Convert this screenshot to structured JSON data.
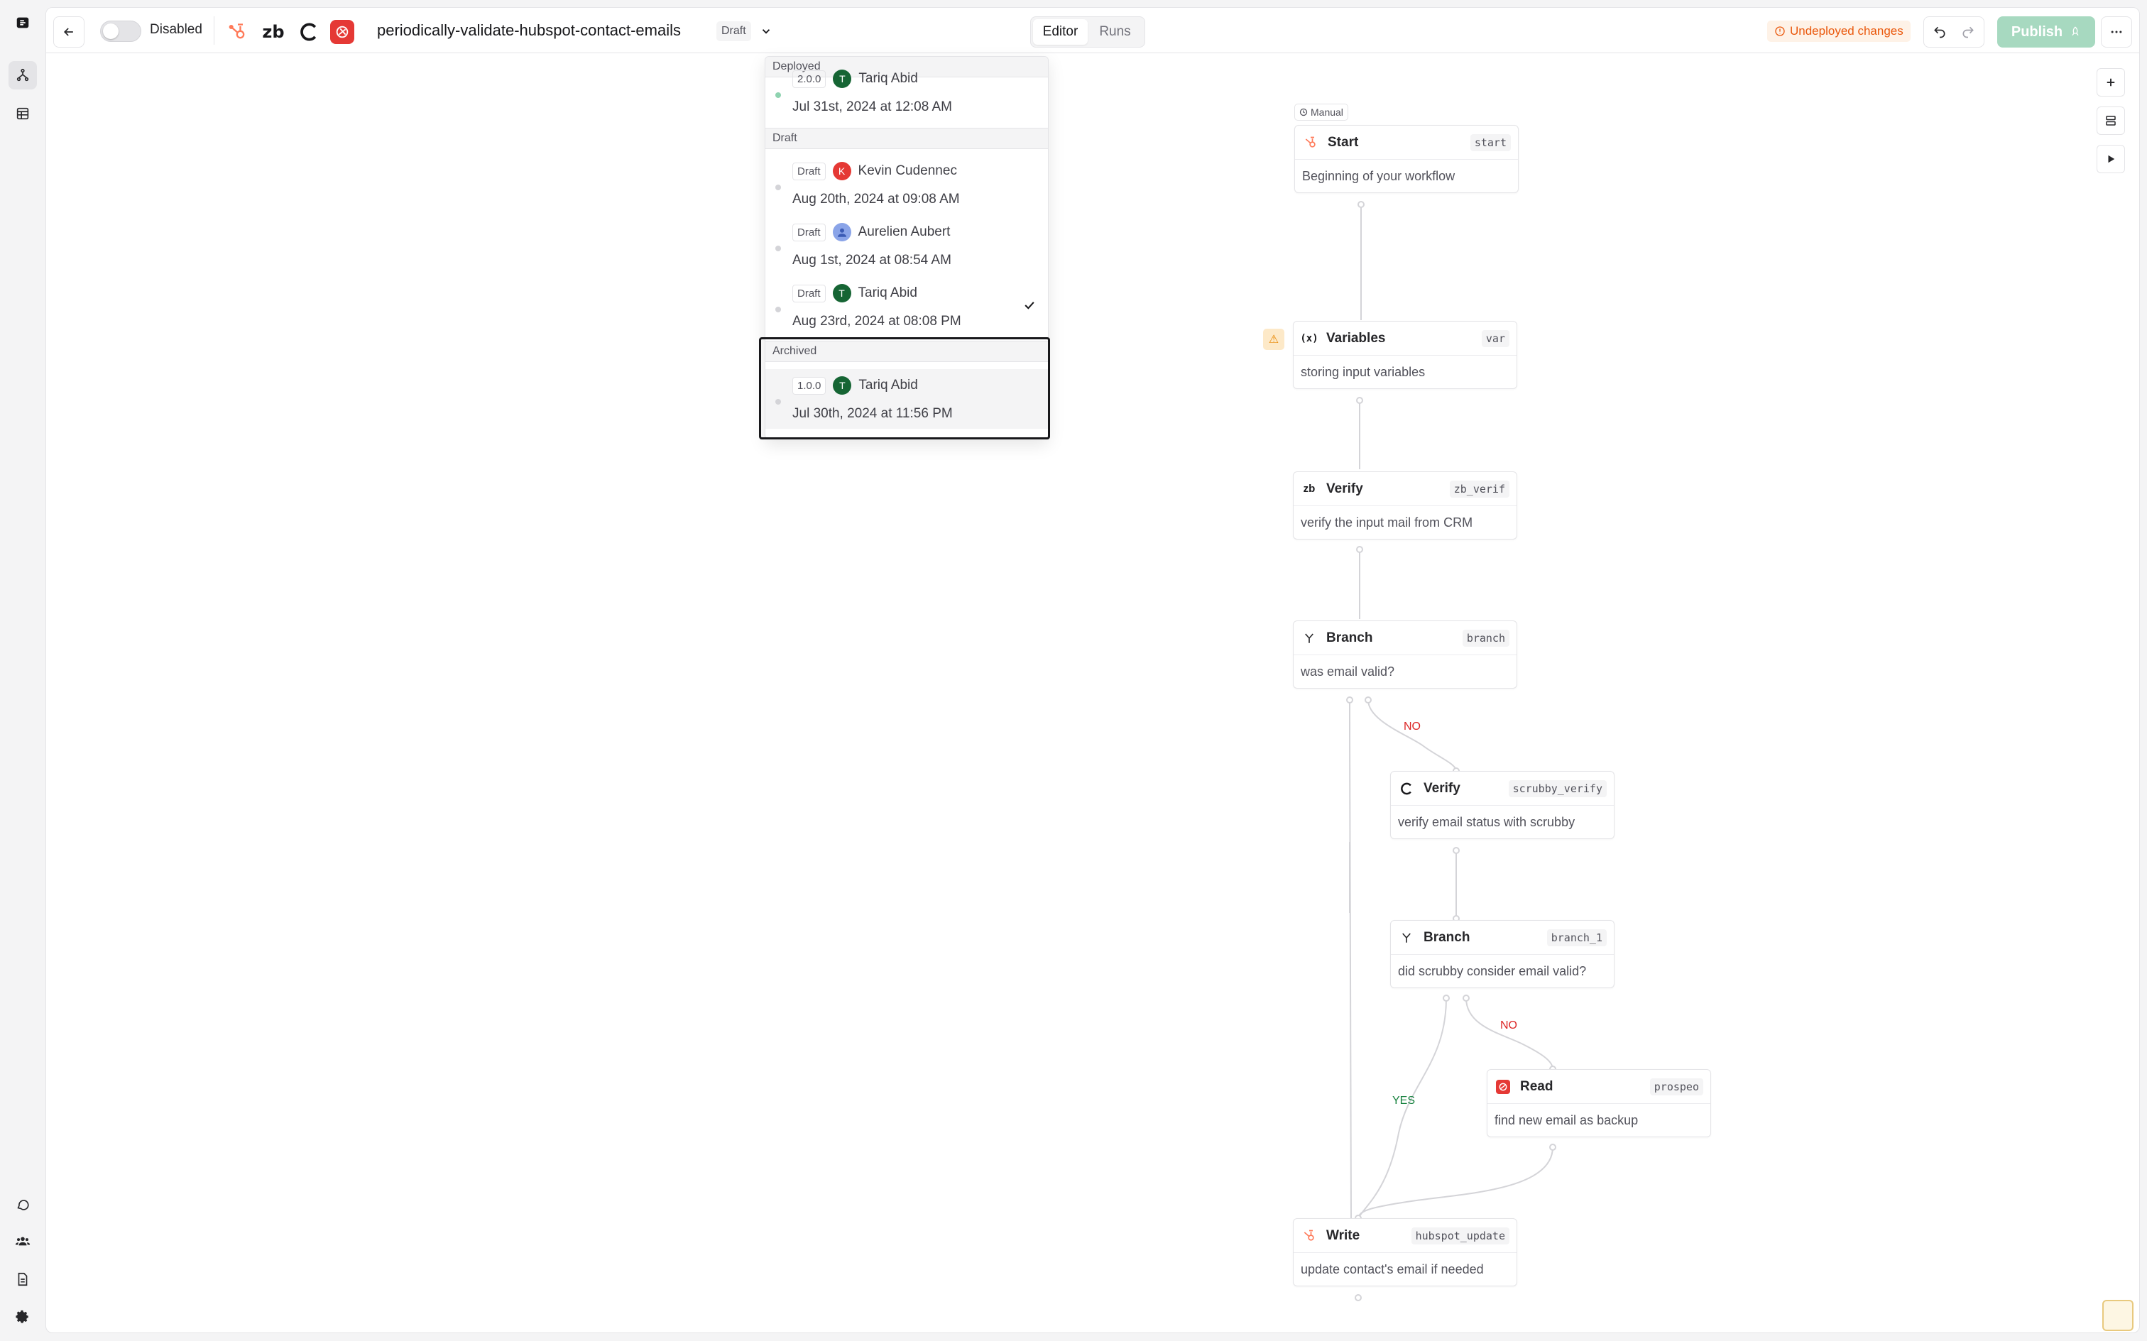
{
  "topbar": {
    "toggle_label": "Disabled",
    "workflow_title": "periodically-validate-hubspot-contact-emails",
    "draft_label": "Draft",
    "tabs": [
      "Editor",
      "Runs"
    ],
    "undeployed_label": "Undeployed changes",
    "publish_label": "Publish",
    "app_icons": [
      "hubspot-icon",
      "zerobounce-icon",
      "scrubby-icon",
      "prospeo-icon"
    ]
  },
  "versions": {
    "sections": {
      "deployed": "Deployed",
      "draft": "Draft",
      "archived": "Archived"
    },
    "deployed": [
      {
        "tag": "2.0.0",
        "author_initial": "T",
        "author": "Tariq Abid",
        "date": "Jul 31st, 2024 at 12:08 AM"
      }
    ],
    "draft": [
      {
        "tag": "Draft",
        "author_initial": "K",
        "author": "Kevin Cudennec",
        "date": "Aug 20th, 2024 at 09:08 AM"
      },
      {
        "tag": "Draft",
        "author_initial": "",
        "author": "Aurelien Aubert",
        "date": "Aug 1st, 2024 at 08:54 AM"
      },
      {
        "tag": "Draft",
        "author_initial": "T",
        "author": "Tariq Abid",
        "date": "Aug 23rd, 2024 at 08:08 PM",
        "selected": true
      }
    ],
    "archived": [
      {
        "tag": "1.0.0",
        "author_initial": "T",
        "author": "Tariq Abid",
        "date": "Jul 30th, 2024 at 11:56 PM"
      }
    ]
  },
  "canvas": {
    "trigger_label": "Manual",
    "nodes": [
      {
        "name": "Start",
        "id": "start",
        "desc": "Beginning of your workflow",
        "icon": "hubspot-icon"
      },
      {
        "name": "Variables",
        "id": "var",
        "desc": "storing input variables",
        "icon": "variables-icon"
      },
      {
        "name": "Verify",
        "id": "zb_verif",
        "desc": "verify the input mail from CRM",
        "icon": "zerobounce-icon"
      },
      {
        "name": "Branch",
        "id": "branch",
        "desc": "was email valid?",
        "icon": "branch-icon"
      },
      {
        "name": "Verify",
        "id": "scrubby_verify",
        "desc": "verify email status with scrubby",
        "icon": "scrubby-icon"
      },
      {
        "name": "Branch",
        "id": "branch_1",
        "desc": "did scrubby consider email valid?",
        "icon": "branch-icon"
      },
      {
        "name": "Read",
        "id": "prospeo",
        "desc": "find new email as backup",
        "icon": "prospeo-icon"
      },
      {
        "name": "Write",
        "id": "hubspot_update",
        "desc": "update contact's email if needed",
        "icon": "hubspot-icon"
      }
    ],
    "edge_labels": {
      "no_1": "NO",
      "no_2": "NO",
      "yes": "YES"
    }
  },
  "colors": {
    "accent_publish": "#a7d9c0",
    "warning": "#ea580c",
    "no_label": "#dc2626",
    "yes_label": "#15803d",
    "hubspot": "#ff7a59",
    "prospeo": "#e53935"
  }
}
